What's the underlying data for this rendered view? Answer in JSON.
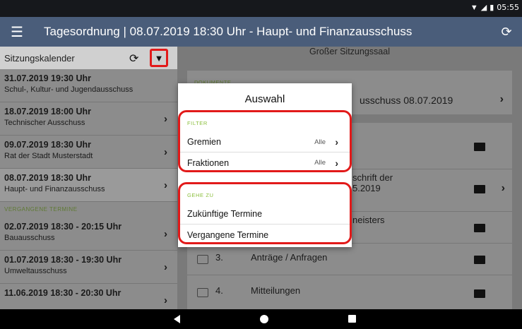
{
  "status_bar": {
    "time": "05:55",
    "wifi_icon": "wifi-icon",
    "signal_icon": "signal-icon",
    "battery_icon": "battery-icon"
  },
  "app_bar": {
    "title": "Tagesordnung | 08.07.2019 18:30 Uhr - Haupt- und Finanzausschuss",
    "menu_icon": "menu-icon",
    "refresh_icon": "refresh-icon"
  },
  "left_pane": {
    "header": "Sitzungskalender",
    "upcoming": [
      {
        "date": "31.07.2019 19:30 Uhr",
        "committee": "Schul-, Kultur- und Jugendausschuss"
      },
      {
        "date": "18.07.2019 18:00 Uhr",
        "committee": "Technischer Ausschuss"
      },
      {
        "date": "09.07.2019 18:30 Uhr",
        "committee": "Rat der Stadt Musterstadt"
      },
      {
        "date": "08.07.2019 18:30 Uhr",
        "committee": "Haupt- und Finanzausschuss"
      }
    ],
    "past_label": "VERGANGENE TERMINE",
    "past": [
      {
        "date": "02.07.2019 18:30 - 20:15 Uhr",
        "committee": "Bauausschuss"
      },
      {
        "date": "01.07.2019 18:30 - 19:30 Uhr",
        "committee": "Umweltausschuss"
      },
      {
        "date": "11.06.2019 18:30 - 20:30 Uhr",
        "committee": ""
      }
    ]
  },
  "right_pane": {
    "location": "Großer Sitzungssaal",
    "documents_label": "DOKUMENTE",
    "documents_text": "usschuss 08.07.2019",
    "rows": [
      {
        "num": "",
        "text": ""
      },
      {
        "num": "",
        "text": "schrift der",
        "text2": "5.2019"
      },
      {
        "num": "",
        "text": "neisters"
      },
      {
        "num": "3.",
        "text": "Anträge / Anfragen"
      },
      {
        "num": "4.",
        "text": "Mitteilungen"
      }
    ]
  },
  "dialog": {
    "title": "Auswahl",
    "filter_label": "FILTER",
    "filter_options": [
      {
        "label": "Gremien",
        "value": "Alle"
      },
      {
        "label": "Fraktionen",
        "value": "Alle"
      }
    ],
    "goto_label": "GEHE ZU",
    "goto_options": [
      {
        "label": "Zukünftige Termine"
      },
      {
        "label": "Vergangene Termine"
      }
    ]
  },
  "colors": {
    "app_bar": "#4a5d7a",
    "highlight": "#e21a1a",
    "section_label": "#8bbf3c"
  }
}
